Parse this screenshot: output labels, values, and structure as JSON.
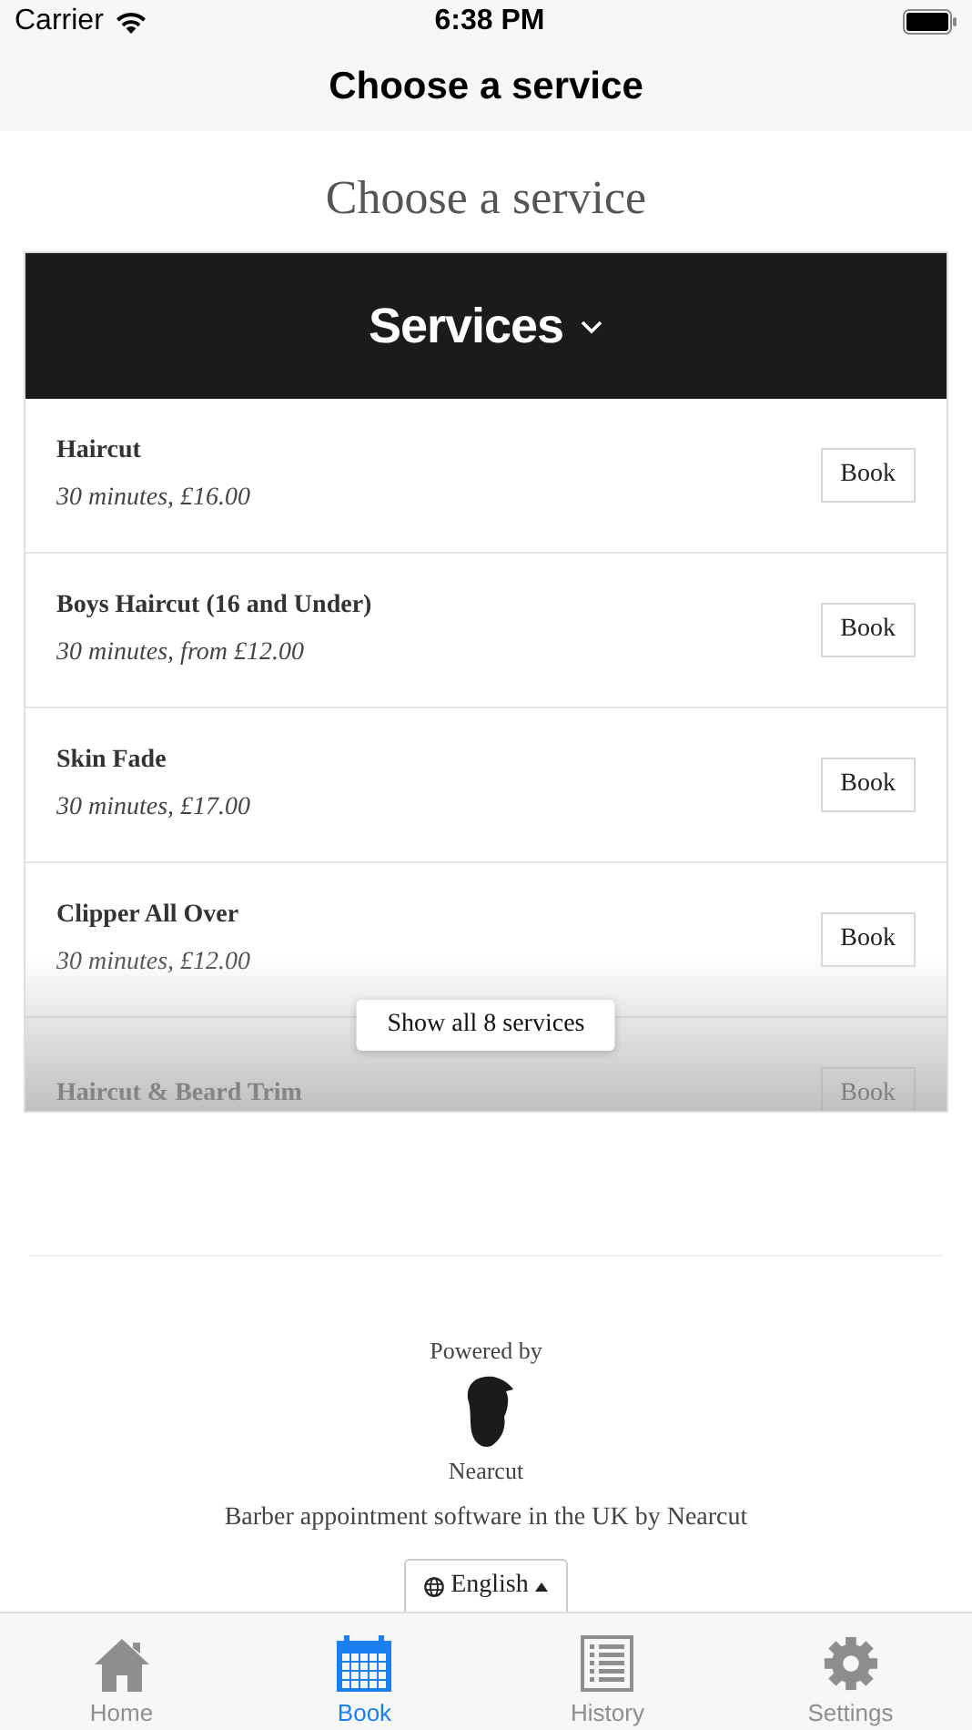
{
  "status_bar": {
    "carrier": "Carrier",
    "time": "6:38 PM"
  },
  "nav_bar": {
    "title": "Choose a service"
  },
  "heading": "Choose a service",
  "services": {
    "title": "Services",
    "expanded": false,
    "items": [
      {
        "name": "Haircut",
        "detail": "30 minutes, £16.00",
        "action": "Book"
      },
      {
        "name": "Boys Haircut (16 and Under)",
        "detail": "30 minutes, from £12.00",
        "action": "Book"
      },
      {
        "name": "Skin Fade",
        "detail": "30 minutes, £17.00",
        "action": "Book"
      },
      {
        "name": "Clipper All Over",
        "detail": "30 minutes, £12.00",
        "action": "Book"
      },
      {
        "name": "Haircut & Beard Trim",
        "action": "Book"
      }
    ],
    "show_all": "Show all 8 services"
  },
  "footer": {
    "powered_by": "Powered by",
    "brand": "Nearcut",
    "tagline": "Barber appointment software in the UK by Nearcut",
    "language": "English"
  },
  "tab_bar": [
    {
      "label": "Home",
      "kind": "home",
      "selected": false
    },
    {
      "label": "Book",
      "kind": "calendar",
      "selected": true
    },
    {
      "label": "History",
      "kind": "list",
      "selected": false
    },
    {
      "label": "Settings",
      "kind": "gear",
      "selected": false
    }
  ]
}
